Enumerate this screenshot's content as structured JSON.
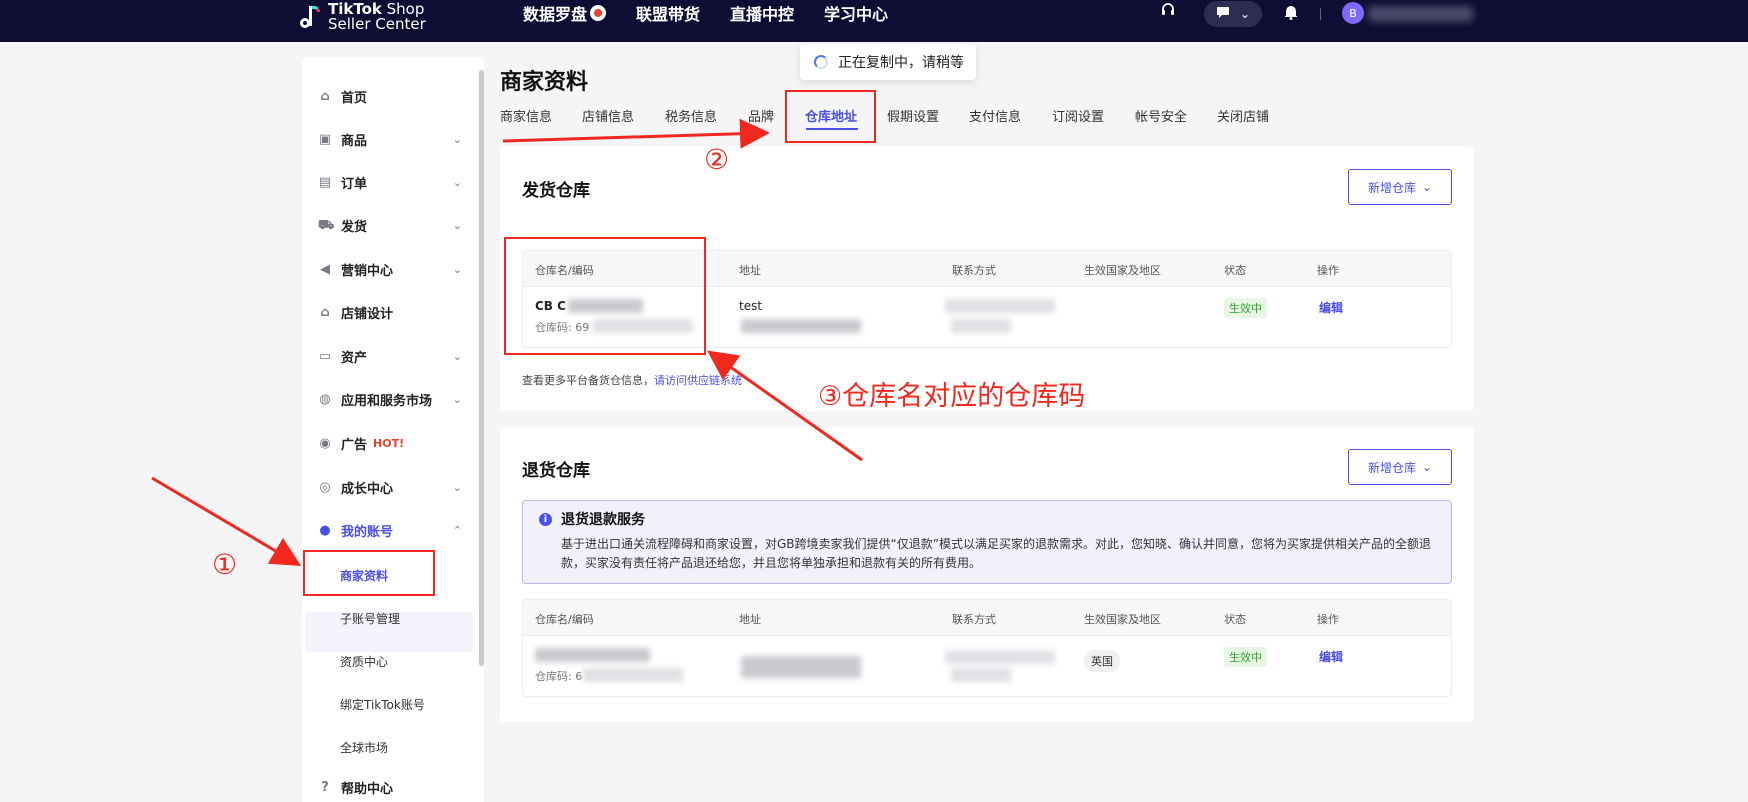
{
  "topbar": {
    "logo_line1_bold": "TikTok",
    "logo_line1_rest": " Shop",
    "logo_line2": "Seller Center",
    "nav": [
      "数据罗盘",
      "联盟带货",
      "直播中控",
      "学习中心"
    ],
    "avatar_letter": "B"
  },
  "toast": {
    "text": "正在复制中，请稍等"
  },
  "sidebar": {
    "items": [
      {
        "label": "首页",
        "icon": "home-icon",
        "glyph": "⌂"
      },
      {
        "label": "商品",
        "icon": "bag-icon",
        "glyph": "▣"
      },
      {
        "label": "订单",
        "icon": "order-icon",
        "glyph": "▤"
      },
      {
        "label": "发货",
        "icon": "truck-icon",
        "glyph": "⛟"
      },
      {
        "label": "营销中心",
        "icon": "megaphone-icon",
        "glyph": "◀"
      },
      {
        "label": "店铺设计",
        "icon": "store-icon",
        "glyph": "⌂"
      },
      {
        "label": "资产",
        "icon": "card-icon",
        "glyph": "▭"
      },
      {
        "label": "应用和服务市场",
        "icon": "globe-icon",
        "glyph": "◍"
      },
      {
        "label": "广告",
        "icon": "ad-icon",
        "glyph": "◉",
        "hot": "HOT!"
      },
      {
        "label": "成长中心",
        "icon": "medal-icon",
        "glyph": "◎"
      },
      {
        "label": "我的账号",
        "icon": "user-icon",
        "glyph": "●"
      }
    ],
    "subitems": [
      "商家资料",
      "子账号管理",
      "资质中心",
      "绑定TikTok账号",
      "全球市场"
    ],
    "help": {
      "label": "帮助中心",
      "glyph": "?"
    }
  },
  "page": {
    "title": "商家资料",
    "tabs": [
      "商家信息",
      "店铺信息",
      "税务信息",
      "品牌",
      "仓库地址",
      "假期设置",
      "支付信息",
      "订阅设置",
      "帐号安全",
      "关闭店铺"
    ],
    "selected_tab": "仓库地址"
  },
  "shipping": {
    "title": "发货仓库",
    "add_button": "新增仓库",
    "columns": [
      "仓库名/编码",
      "地址",
      "联系方式",
      "生效国家及地区",
      "状态",
      "操作"
    ],
    "row": {
      "name": "CB C",
      "code": "仓库码: 69",
      "address": "test",
      "status": "生效中",
      "action": "编辑"
    },
    "note_text": "查看更多平台备货仓信息，",
    "note_link": "请访问供应链系统"
  },
  "returns": {
    "title": "退货仓库",
    "add_button": "新增仓库",
    "notice_title": "退货退款服务",
    "notice_body": "基于进出口通关流程障碍和商家设置，对GB跨境卖家我们提供“仅退款”模式以满足买家的退款需求。对此，您知晓、确认并同意，您将为买家提供相关产品的全额退款，买家没有责任将产品退还给您，并且您将单独承担和退款有关的所有费用。",
    "columns": [
      "仓库名/编码",
      "地址",
      "联系方式",
      "生效国家及地区",
      "状态",
      "操作"
    ],
    "row": {
      "code": "仓库码: 6",
      "region": "英国",
      "status": "生效中",
      "action": "编辑"
    }
  },
  "annotations": {
    "step1": "①",
    "step2": "②",
    "step3": "③仓库名对应的仓库码"
  },
  "colors": {
    "topbar": "#0e0d33",
    "accent": "#4a4fe8",
    "annotation": "#f0281e",
    "success": "#2ea32e"
  }
}
